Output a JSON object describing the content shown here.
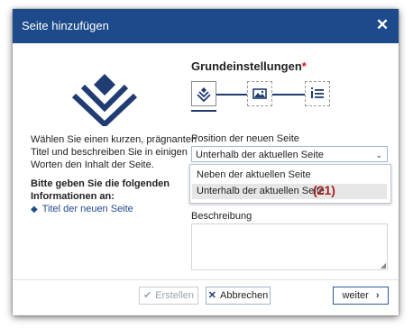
{
  "dialog": {
    "title": "Seite hinzufügen",
    "close_icon": "close-icon",
    "accent_color": "#1c4a8a"
  },
  "left": {
    "logo_icon": "layers-logo-icon",
    "intro": "Wählen Sie einen kurzen, prägnanten Titel und beschreiben Sie in einigen Worten den Inhalt der Seite.",
    "required_heading": "Bitte geben Sie die folgenden Informationen an:",
    "required_item": "Titel der neuen Seite"
  },
  "wizard": {
    "section_title": "Grundeinstellungen",
    "required_marker": "*",
    "steps": [
      {
        "icon": "layers-icon",
        "active": true
      },
      {
        "icon": "image-icon",
        "active": false
      },
      {
        "icon": "info-list-icon",
        "active": false
      }
    ]
  },
  "position": {
    "label": "Position der neuen Seite",
    "selected": "Unterhalb der aktuellen Seite",
    "options": [
      "Neben der aktuellen Seite",
      "Unterhalb der aktuellen Seite"
    ],
    "badge": "(21)"
  },
  "description": {
    "label": "Beschreibung",
    "value": ""
  },
  "footer": {
    "create_label": "Erstellen",
    "cancel_label": "Abbrechen",
    "next_label": "weiter"
  }
}
